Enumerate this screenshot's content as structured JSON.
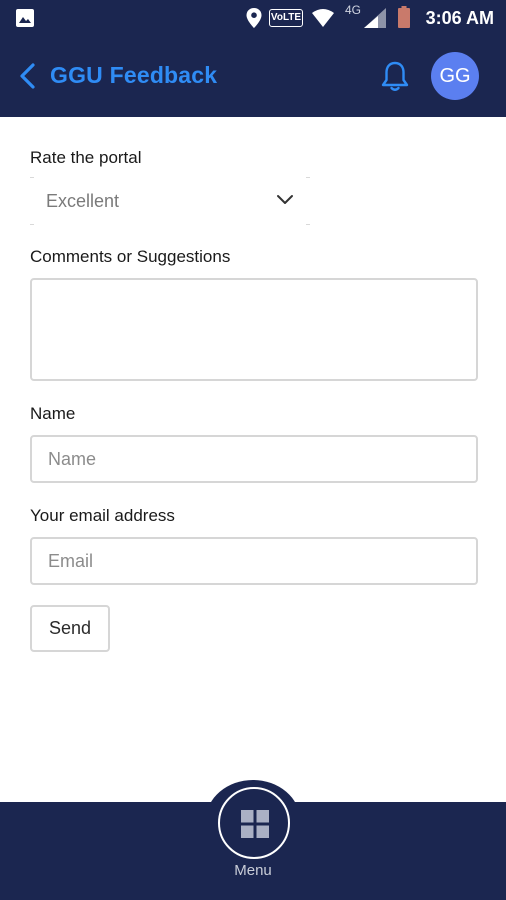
{
  "status_bar": {
    "volte": "VoLTE",
    "network": "4G",
    "time": "3:06 AM",
    "icons": [
      "gallery-icon",
      "location-icon",
      "wifi-icon",
      "signal-icon",
      "battery-icon"
    ]
  },
  "app_bar": {
    "title": "GGU Feedback",
    "avatar_initials": "GG",
    "icons": [
      "back-chevron-icon",
      "bell-icon"
    ]
  },
  "form": {
    "rate_label": "Rate the portal",
    "rate_value": "Excellent",
    "comments_label": "Comments or Suggestions",
    "comments_value": "",
    "name_label": "Name",
    "name_placeholder": "Name",
    "email_label": "Your email address",
    "email_placeholder": "Email",
    "send_label": "Send"
  },
  "bottom_nav": {
    "menu_label": "Menu",
    "icon": "grid-icon"
  },
  "colors": {
    "bar_background": "#1b2650",
    "accent_blue": "#2f8cf5",
    "avatar_background": "#5b7ff0",
    "field_border": "#d6d6d6"
  }
}
